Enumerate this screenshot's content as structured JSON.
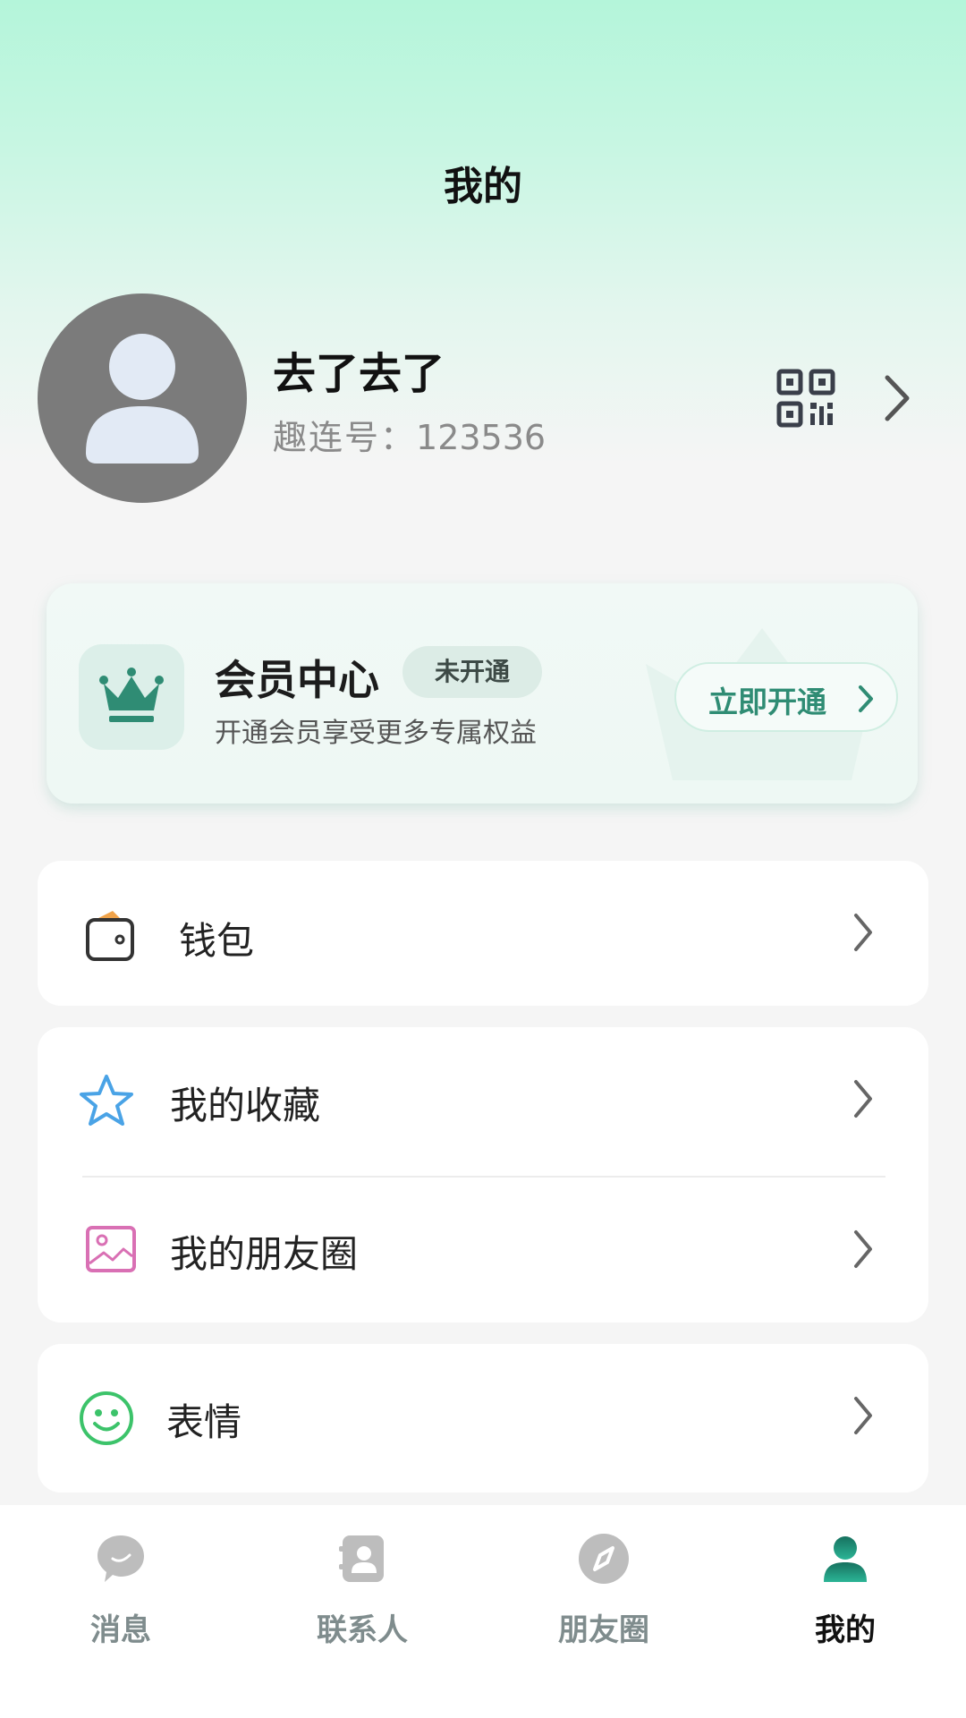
{
  "header": {
    "title": "我的"
  },
  "profile": {
    "nickname": "去了去了",
    "account_label": "趣连号：",
    "account_id": "123536"
  },
  "vip": {
    "title": "会员中心",
    "badge": "未开通",
    "description": "开通会员享受更多专属权益",
    "button_label": "立即开通"
  },
  "menu": {
    "wallet": {
      "label": "钱包",
      "icon": "wallet-icon"
    },
    "favorites": {
      "label": "我的收藏",
      "icon": "star-icon"
    },
    "moments": {
      "label": "我的朋友圈",
      "icon": "picture-icon"
    },
    "stickers": {
      "label": "表情",
      "icon": "smile-icon"
    }
  },
  "tabs": [
    {
      "label": "消息",
      "icon": "chat-bubble-icon",
      "active": false
    },
    {
      "label": "联系人",
      "icon": "contacts-icon",
      "active": false
    },
    {
      "label": "朋友圈",
      "icon": "compass-icon",
      "active": false
    },
    {
      "label": "我的",
      "icon": "person-icon",
      "active": true
    }
  ],
  "colors": {
    "accent": "#2f8c74",
    "active_tab": "#1e8c77",
    "inactive_tab": "#b9b9b9",
    "star": "#4aa3e6",
    "picture": "#d970b4",
    "smile": "#3cc36a"
  }
}
